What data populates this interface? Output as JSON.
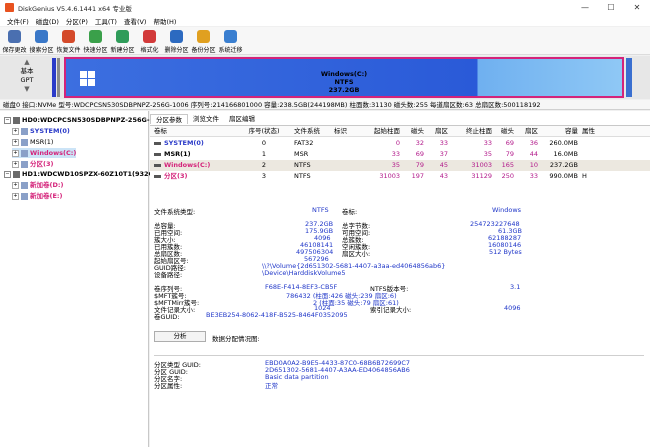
{
  "window": {
    "title": "DiskGenius V5.4.6.1441 x64 专业版",
    "controls": [
      "—",
      "☐",
      "✕"
    ]
  },
  "menu": [
    "文件(F)",
    "磁盘(D)",
    "分区(P)",
    "工具(T)",
    "查看(V)",
    "帮助(H)"
  ],
  "toolbar": [
    {
      "label": "保存更改",
      "icon": "save-icon",
      "color": "#4a6fb0"
    },
    {
      "label": "搜索分区",
      "icon": "search-partition-icon",
      "color": "#3a78c8"
    },
    {
      "label": "恢复文件",
      "icon": "recover-file-icon",
      "color": "#d44a2a"
    },
    {
      "label": "快速分区",
      "icon": "quick-partition-icon",
      "color": "#3aa04a"
    },
    {
      "label": "新建分区",
      "icon": "new-partition-icon",
      "color": "#2f9c5a"
    },
    {
      "label": "格式化",
      "icon": "format-icon",
      "color": "#d23a3a"
    },
    {
      "label": "删除分区",
      "icon": "delete-partition-icon",
      "color": "#2c6ac0"
    },
    {
      "label": "备份分区",
      "icon": "backup-partition-icon",
      "color": "#e0a020"
    },
    {
      "label": "系统迁移",
      "icon": "system-migrate-icon",
      "color": "#3a7fd0"
    }
  ],
  "diskmap": {
    "type_label1": "基本",
    "type_label2": "GPT",
    "partition_name": "Windows(C:)",
    "partition_fs": "NTFS",
    "partition_size": "237.2GB",
    "colors": {
      "selected_border": "#d4237a",
      "used": "#2a5ad8",
      "free": "#8fc8f5"
    }
  },
  "disk_info": "磁盘0 接口:NVMe  型号:WDCPCSN530SDBPNPZ-256G-1006  序列号:214166801000  容量:238.5GB(244198MB)  柱面数:31130  磁头数:255  每道扇区数:63  总扇区数:500118192",
  "tree": [
    {
      "label": "HD0:WDCPCSN530SDBPNPZ-256G-1006",
      "level": 0,
      "bold": true,
      "color": "#000"
    },
    {
      "label": "SYSTEM(0)",
      "level": 1,
      "bold": true,
      "color": "#2a3ac8"
    },
    {
      "label": "MSR(1)",
      "level": 1,
      "bold": false,
      "color": "#000"
    },
    {
      "label": "Windows(C:)",
      "level": 1,
      "bold": true,
      "color": "#d4237a",
      "selected": true
    },
    {
      "label": "分区(3)",
      "level": 1,
      "bold": true,
      "color": "#d4237a"
    },
    {
      "label": "HD1:WDCWD10SPZX-60Z10T1(932GB)",
      "level": 0,
      "bold": true,
      "color": "#000"
    },
    {
      "label": "新加卷(D:)",
      "level": 1,
      "bold": true,
      "color": "#d4237a"
    },
    {
      "label": "新加卷(E:)",
      "level": 1,
      "bold": true,
      "color": "#d4237a"
    }
  ],
  "tabs": [
    "分区参数",
    "浏览文件",
    "扇区编辑"
  ],
  "partition_table": {
    "headers": [
      "卷标",
      "序号(状态)",
      "文件系统",
      "标识",
      "起始柱面",
      "磁头",
      "扇区",
      "终止柱面",
      "磁头",
      "扇区",
      "容量",
      "属性"
    ],
    "rows": [
      {
        "name": "SYSTEM(0)",
        "index": "0",
        "fs": "FAT32",
        "id": "",
        "c1": "0",
        "h1": "32",
        "s1": "33",
        "c2": "33",
        "h2": "69",
        "s2": "36",
        "size": "260.0MB",
        "attr": "",
        "color": "#2a3ac8",
        "selected": false
      },
      {
        "name": "MSR(1)",
        "index": "1",
        "fs": "MSR",
        "id": "",
        "c1": "33",
        "h1": "69",
        "s1": "37",
        "c2": "35",
        "h2": "79",
        "s2": "44",
        "size": "16.0MB",
        "attr": "",
        "color": "#000",
        "selected": false
      },
      {
        "name": "Windows(C:)",
        "index": "2",
        "fs": "NTFS",
        "id": "",
        "c1": "35",
        "h1": "79",
        "s1": "45",
        "c2": "31003",
        "h2": "165",
        "s2": "10",
        "size": "237.2GB",
        "attr": "",
        "color": "#d4237a",
        "selected": true
      },
      {
        "name": "分区(3)",
        "index": "3",
        "fs": "NTFS",
        "id": "",
        "c1": "31003",
        "h1": "197",
        "s1": "43",
        "c2": "31129",
        "h2": "250",
        "s2": "33",
        "size": "990.0MB",
        "attr": "H",
        "color": "#d4237a",
        "selected": false
      }
    ]
  },
  "fs_info": {
    "fs_type_label": "文件系统类型:",
    "fs_type": "NTFS",
    "volume_label_label": "卷标:",
    "volume_label": "Windows",
    "total_label": "总容量:",
    "total": "237.2GB",
    "total_bytes_label": "总字节数:",
    "total_bytes": "254723227648",
    "used_label": "已用空间:",
    "used": "175.9GB",
    "free_label": "可用空间:",
    "free": "61.3GB",
    "cluster_label": "簇大小:",
    "cluster": "4096",
    "total_clusters_label": "总簇数:",
    "total_clusters": "62188287",
    "used_clusters_label": "已用簇数:",
    "used_clusters": "46108141",
    "free_clusters_label": "空闲簇数:",
    "free_clusters": "16080146",
    "total_sectors_label": "总扇区数:",
    "total_sectors": "497506304",
    "sector_size_label": "扇区大小:",
    "sector_size": "512 Bytes",
    "start_sector_label": "起始扇区号:",
    "start_sector": "567296",
    "guid_path_label": "GUID路径:",
    "guid_path": "\\\\?\\Volume{2d651302-5681-4407-a3aa-ed4064856ab6}",
    "device_path_label": "设备路径:",
    "device_path": "\\Device\\HarddiskVolume5",
    "serial_label": "卷序列号:",
    "serial": "F68E-F414-8EF3-CB5F",
    "ntfs_ver_label": "NTFS版本号:",
    "ntfs_ver": "3.1",
    "mft_label": "$MFT簇号:",
    "mft": "786432 (柱面:426 磁头:239 扇区:6)",
    "mftmirr_label": "$MFTMirr簇号:",
    "mftmirr": "2 (柱面:35 磁头:79 扇区:61)",
    "record_size_label": "文件记录大小:",
    "record_size": "1024",
    "index_size_label": "索引记录大小:",
    "index_size": "4096",
    "vol_guid_label": "卷GUID:",
    "vol_guid": "BE3EB254-8062-418F-B525-8464F0352095"
  },
  "analyze_button": "分析",
  "alloc_label": "数据分配情况图:",
  "gpt_info": {
    "type_guid_label": "分区类型 GUID:",
    "type_guid": "EBD0A0A2-B9E5-4433-87C0-68B6B72699C7",
    "part_guid_label": "分区 GUID:",
    "part_guid": "2D651302-5681-4407-A3AA-ED4064856AB6",
    "name_label": "分区名字:",
    "name": "Basic data partition",
    "attr_label": "分区属性:",
    "attr": "正常"
  }
}
